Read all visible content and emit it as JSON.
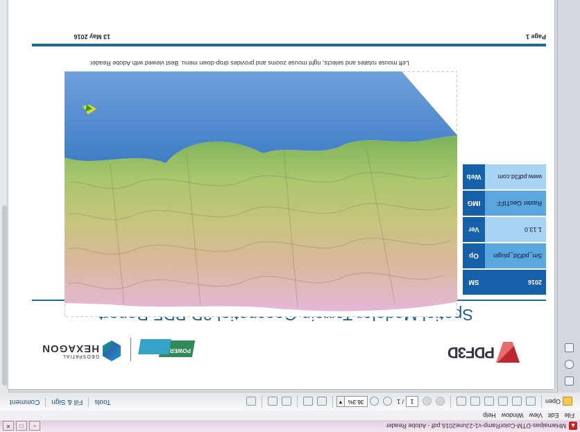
{
  "window": {
    "title": "MHamaipas-DTM-ColorRamp-v1-2June2016.pdf - Adobe Reader",
    "controls": [
      "–",
      "□",
      "✕"
    ]
  },
  "menu": [
    "File",
    "Edit",
    "View",
    "Window",
    "Help"
  ],
  "toolbar": {
    "open_label": "Open",
    "page_current": "1",
    "page_total": "/ 1",
    "zoom": "36.3%",
    "tools_label": "Tools",
    "fill_sign_label": "Fill & Sign",
    "comment_label": "Comment"
  },
  "document": {
    "header_logo_pdf3d": "PDF3D",
    "header_logo_power": "POWER",
    "header_logo_hexagon": "HEXAGON",
    "header_logo_hexagon_sub": "GEOSPATIAL",
    "report_title": "Spatial Modeler Terrain Geospatial 3D PDF Report",
    "info_table": [
      {
        "key": "SM",
        "value": "2016"
      },
      {
        "key": "Op",
        "value": "Sm_pdf3d_plugin"
      },
      {
        "key": "Ver",
        "value": "1.13.0"
      },
      {
        "key": "IMG",
        "value": "Raster GeoTIFF"
      },
      {
        "key": "Web",
        "value": "www.pdf3d.com"
      }
    ],
    "instruction": "Left mouse rotates and selects, right mouse zooms and provides drop-down menu. Best viewed with Adobe Reader.",
    "footer_page": "Page 1",
    "footer_date": "13 May 2016"
  },
  "colors": {
    "accent": "#1c6a96",
    "table_dark": "#1560a8",
    "table_mid": "#5aa7e0",
    "table_light": "#a8d3f2",
    "sea": "#5b8fd0"
  }
}
